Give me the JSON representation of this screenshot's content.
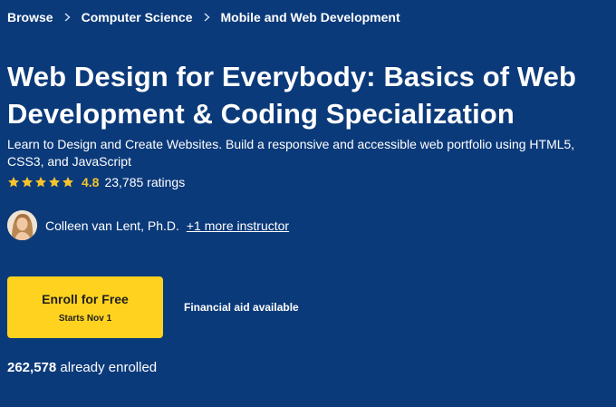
{
  "breadcrumb": {
    "items": [
      {
        "label": "Browse"
      },
      {
        "label": "Computer Science"
      },
      {
        "label": "Mobile and Web Development"
      }
    ],
    "separator_icon": "chevron-right-icon"
  },
  "course": {
    "title": "Web Design for Everybody: Basics of Web Development & Coding Specialization",
    "subtitle": "Learn to Design and Create Websites. Build a responsive and accessible web portfolio using HTML5, CSS3, and JavaScript"
  },
  "rating": {
    "stars": 5,
    "value": "4.8",
    "count_text": "23,785 ratings",
    "star_color": "#f5c32c"
  },
  "instructor": {
    "name": "Colleen van Lent, Ph.D.",
    "more_link": "+1 more instructor"
  },
  "enroll": {
    "label": "Enroll for Free",
    "date": "Starts Nov 1",
    "button_color": "#ffd21f"
  },
  "financial_aid": "Financial aid available",
  "enrolled": {
    "count": "262,578",
    "suffix": "already enrolled"
  },
  "colors": {
    "background": "#0b3a7a",
    "text": "#ffffff"
  }
}
